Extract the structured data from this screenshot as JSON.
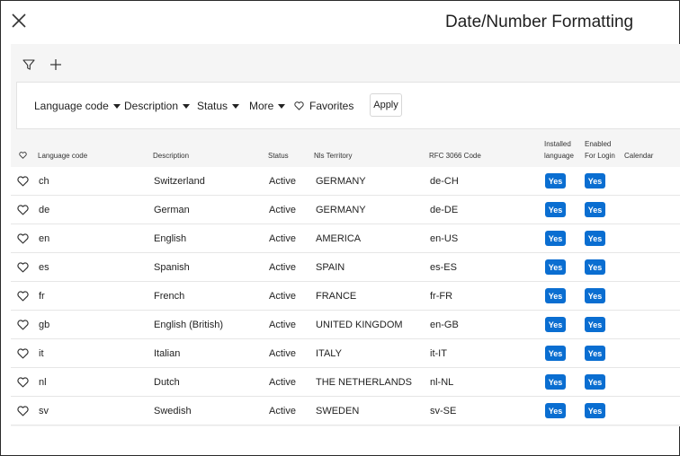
{
  "header": {
    "title": "Date/Number Formatting",
    "close_icon": "close-icon"
  },
  "toolbar": {
    "filter_icon": "filter-icon",
    "add_icon": "plus-icon"
  },
  "filters": {
    "language_code": "Language code",
    "description": "Description",
    "status": "Status",
    "more": "More",
    "favorites": "Favorites",
    "apply": "Apply"
  },
  "columns": {
    "favorite_icon": "heart-icon",
    "language_code": "Language code",
    "description": "Description",
    "status": "Status",
    "nls_territory": "Nls Territory",
    "rfc_code": "RFC 3066 Code",
    "installed_line1": "Installed",
    "installed_line2": "language",
    "enabled_line1": "Enabled",
    "enabled_line2": "For Login",
    "calendar": "Calendar"
  },
  "rows": [
    {
      "code": "ch",
      "description": "Switzerland",
      "status": "Active",
      "territory": "GERMANY",
      "rfc": "de-CH",
      "installed": "Yes",
      "enabled": "Yes"
    },
    {
      "code": "de",
      "description": "German",
      "status": "Active",
      "territory": "GERMANY",
      "rfc": "de-DE",
      "installed": "Yes",
      "enabled": "Yes"
    },
    {
      "code": "en",
      "description": "English",
      "status": "Active",
      "territory": "AMERICA",
      "rfc": "en-US",
      "installed": "Yes",
      "enabled": "Yes"
    },
    {
      "code": "es",
      "description": "Spanish",
      "status": "Active",
      "territory": "SPAIN",
      "rfc": "es-ES",
      "installed": "Yes",
      "enabled": "Yes"
    },
    {
      "code": "fr",
      "description": "French",
      "status": "Active",
      "territory": "FRANCE",
      "rfc": "fr-FR",
      "installed": "Yes",
      "enabled": "Yes"
    },
    {
      "code": "gb",
      "description": "English (British)",
      "status": "Active",
      "territory": "UNITED KINGDOM",
      "rfc": "en-GB",
      "installed": "Yes",
      "enabled": "Yes"
    },
    {
      "code": "it",
      "description": "Italian",
      "status": "Active",
      "territory": "ITALY",
      "rfc": "it-IT",
      "installed": "Yes",
      "enabled": "Yes"
    },
    {
      "code": "nl",
      "description": "Dutch",
      "status": "Active",
      "territory": "THE NETHERLANDS",
      "rfc": "nl-NL",
      "installed": "Yes",
      "enabled": "Yes"
    },
    {
      "code": "sv",
      "description": "Swedish",
      "status": "Active",
      "territory": "SWEDEN",
      "rfc": "sv-SE",
      "installed": "Yes",
      "enabled": "Yes"
    }
  ],
  "colors": {
    "accent": "#0a6ed1",
    "panel_bg": "#f5f5f5"
  }
}
